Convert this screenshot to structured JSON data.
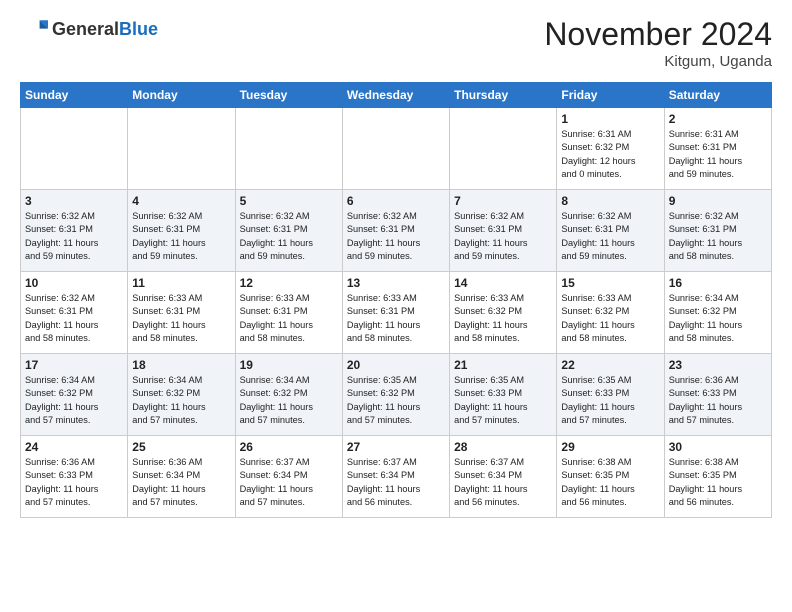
{
  "header": {
    "logo_line1": "General",
    "logo_line2": "Blue",
    "month_title": "November 2024",
    "location": "Kitgum, Uganda"
  },
  "weekdays": [
    "Sunday",
    "Monday",
    "Tuesday",
    "Wednesday",
    "Thursday",
    "Friday",
    "Saturday"
  ],
  "weeks": [
    [
      {
        "day": "",
        "info": ""
      },
      {
        "day": "",
        "info": ""
      },
      {
        "day": "",
        "info": ""
      },
      {
        "day": "",
        "info": ""
      },
      {
        "day": "",
        "info": ""
      },
      {
        "day": "1",
        "info": "Sunrise: 6:31 AM\nSunset: 6:32 PM\nDaylight: 12 hours\nand 0 minutes."
      },
      {
        "day": "2",
        "info": "Sunrise: 6:31 AM\nSunset: 6:31 PM\nDaylight: 11 hours\nand 59 minutes."
      }
    ],
    [
      {
        "day": "3",
        "info": "Sunrise: 6:32 AM\nSunset: 6:31 PM\nDaylight: 11 hours\nand 59 minutes."
      },
      {
        "day": "4",
        "info": "Sunrise: 6:32 AM\nSunset: 6:31 PM\nDaylight: 11 hours\nand 59 minutes."
      },
      {
        "day": "5",
        "info": "Sunrise: 6:32 AM\nSunset: 6:31 PM\nDaylight: 11 hours\nand 59 minutes."
      },
      {
        "day": "6",
        "info": "Sunrise: 6:32 AM\nSunset: 6:31 PM\nDaylight: 11 hours\nand 59 minutes."
      },
      {
        "day": "7",
        "info": "Sunrise: 6:32 AM\nSunset: 6:31 PM\nDaylight: 11 hours\nand 59 minutes."
      },
      {
        "day": "8",
        "info": "Sunrise: 6:32 AM\nSunset: 6:31 PM\nDaylight: 11 hours\nand 59 minutes."
      },
      {
        "day": "9",
        "info": "Sunrise: 6:32 AM\nSunset: 6:31 PM\nDaylight: 11 hours\nand 58 minutes."
      }
    ],
    [
      {
        "day": "10",
        "info": "Sunrise: 6:32 AM\nSunset: 6:31 PM\nDaylight: 11 hours\nand 58 minutes."
      },
      {
        "day": "11",
        "info": "Sunrise: 6:33 AM\nSunset: 6:31 PM\nDaylight: 11 hours\nand 58 minutes."
      },
      {
        "day": "12",
        "info": "Sunrise: 6:33 AM\nSunset: 6:31 PM\nDaylight: 11 hours\nand 58 minutes."
      },
      {
        "day": "13",
        "info": "Sunrise: 6:33 AM\nSunset: 6:31 PM\nDaylight: 11 hours\nand 58 minutes."
      },
      {
        "day": "14",
        "info": "Sunrise: 6:33 AM\nSunset: 6:32 PM\nDaylight: 11 hours\nand 58 minutes."
      },
      {
        "day": "15",
        "info": "Sunrise: 6:33 AM\nSunset: 6:32 PM\nDaylight: 11 hours\nand 58 minutes."
      },
      {
        "day": "16",
        "info": "Sunrise: 6:34 AM\nSunset: 6:32 PM\nDaylight: 11 hours\nand 58 minutes."
      }
    ],
    [
      {
        "day": "17",
        "info": "Sunrise: 6:34 AM\nSunset: 6:32 PM\nDaylight: 11 hours\nand 57 minutes."
      },
      {
        "day": "18",
        "info": "Sunrise: 6:34 AM\nSunset: 6:32 PM\nDaylight: 11 hours\nand 57 minutes."
      },
      {
        "day": "19",
        "info": "Sunrise: 6:34 AM\nSunset: 6:32 PM\nDaylight: 11 hours\nand 57 minutes."
      },
      {
        "day": "20",
        "info": "Sunrise: 6:35 AM\nSunset: 6:32 PM\nDaylight: 11 hours\nand 57 minutes."
      },
      {
        "day": "21",
        "info": "Sunrise: 6:35 AM\nSunset: 6:33 PM\nDaylight: 11 hours\nand 57 minutes."
      },
      {
        "day": "22",
        "info": "Sunrise: 6:35 AM\nSunset: 6:33 PM\nDaylight: 11 hours\nand 57 minutes."
      },
      {
        "day": "23",
        "info": "Sunrise: 6:36 AM\nSunset: 6:33 PM\nDaylight: 11 hours\nand 57 minutes."
      }
    ],
    [
      {
        "day": "24",
        "info": "Sunrise: 6:36 AM\nSunset: 6:33 PM\nDaylight: 11 hours\nand 57 minutes."
      },
      {
        "day": "25",
        "info": "Sunrise: 6:36 AM\nSunset: 6:34 PM\nDaylight: 11 hours\nand 57 minutes."
      },
      {
        "day": "26",
        "info": "Sunrise: 6:37 AM\nSunset: 6:34 PM\nDaylight: 11 hours\nand 57 minutes."
      },
      {
        "day": "27",
        "info": "Sunrise: 6:37 AM\nSunset: 6:34 PM\nDaylight: 11 hours\nand 56 minutes."
      },
      {
        "day": "28",
        "info": "Sunrise: 6:37 AM\nSunset: 6:34 PM\nDaylight: 11 hours\nand 56 minutes."
      },
      {
        "day": "29",
        "info": "Sunrise: 6:38 AM\nSunset: 6:35 PM\nDaylight: 11 hours\nand 56 minutes."
      },
      {
        "day": "30",
        "info": "Sunrise: 6:38 AM\nSunset: 6:35 PM\nDaylight: 11 hours\nand 56 minutes."
      }
    ]
  ]
}
